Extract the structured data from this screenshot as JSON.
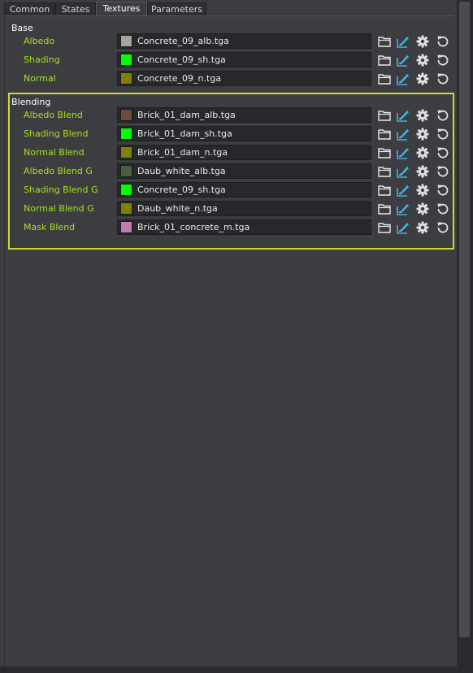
{
  "tabs": [
    {
      "label": "Common",
      "active": false
    },
    {
      "label": "States",
      "active": false
    },
    {
      "label": "Textures",
      "active": true
    },
    {
      "label": "Parameters",
      "active": false
    }
  ],
  "colors": {
    "label_green": "#a6e022",
    "highlight_border": "#d8d435",
    "icon_blue": "#3fb3ea"
  },
  "sections": {
    "base": {
      "title": "Base",
      "rows": [
        {
          "label": "Albedo",
          "file": "Concrete_09_alb.tga",
          "swatch": "#a9a496"
        },
        {
          "label": "Shading",
          "file": "Concrete_09_sh.tga",
          "swatch": "#00ff00"
        },
        {
          "label": "Normal",
          "file": "Concrete_09_n.tga",
          "swatch": "#7f7f00"
        }
      ]
    },
    "blending": {
      "title": "Blending",
      "rows": [
        {
          "label": "Albedo Blend",
          "file": "Brick_01_dam_alb.tga",
          "swatch": "#6e4a3a"
        },
        {
          "label": "Shading Blend",
          "file": "Brick_01_dam_sh.tga",
          "swatch": "#00ff00"
        },
        {
          "label": "Normal Blend",
          "file": "Brick_01_dam_n.tga",
          "swatch": "#7f7f00"
        },
        {
          "label": "Albedo Blend G",
          "file": "Daub_white_alb.tga",
          "swatch": "#4a5e3c"
        },
        {
          "label": "Shading Blend G",
          "file": "Concrete_09_sh.tga",
          "swatch": "#00ff00"
        },
        {
          "label": "Normal Blend G",
          "file": "Daub_white_n.tga",
          "swatch": "#7f7f00"
        },
        {
          "label": "Mask Blend",
          "file": "Brick_01_concrete_m.tga",
          "swatch": "#c27aa8"
        }
      ]
    }
  },
  "row_icons": [
    "folder-icon",
    "edit-icon",
    "gear-icon",
    "reset-icon"
  ]
}
